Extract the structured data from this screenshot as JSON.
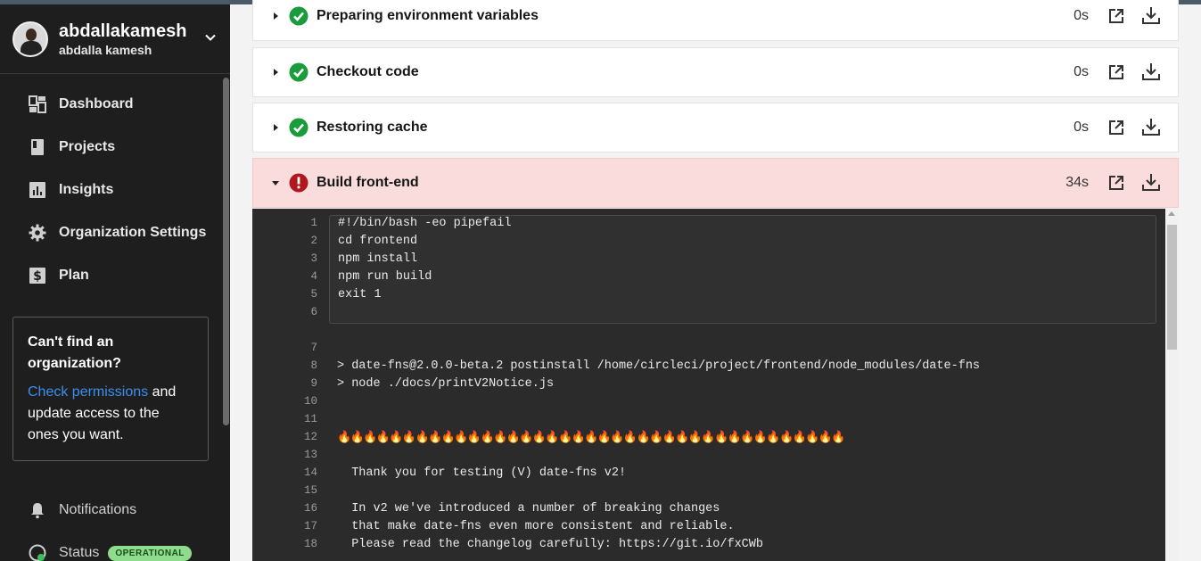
{
  "user": {
    "username": "abdallakamesh",
    "fullname": "abdalla kamesh"
  },
  "nav": [
    {
      "label": "Dashboard",
      "icon": "dashboard-icon"
    },
    {
      "label": "Projects",
      "icon": "projects-icon"
    },
    {
      "label": "Insights",
      "icon": "insights-icon"
    },
    {
      "label": "Organization Settings",
      "icon": "gear-icon"
    },
    {
      "label": "Plan",
      "icon": "dollar-icon"
    }
  ],
  "cant_find": {
    "title": "Can't find an organization?",
    "link": "Check permissions",
    "rest_1": " and",
    "rest_2": "update access to the ones you want."
  },
  "nav_bottom": {
    "notifications": "Notifications",
    "status": "Status",
    "status_badge": "OPERATIONAL"
  },
  "steps": [
    {
      "name": "Preparing environment variables",
      "duration": "0s",
      "state": "success"
    },
    {
      "name": "Checkout code",
      "duration": "0s",
      "state": "success"
    },
    {
      "name": "Restoring cache",
      "duration": "0s",
      "state": "success"
    },
    {
      "name": "Build front-end",
      "duration": "34s",
      "state": "failed"
    }
  ],
  "console": {
    "lines": [
      {
        "n": "1",
        "t": "#!/bin/bash -eo pipefail"
      },
      {
        "n": "2",
        "t": "cd frontend"
      },
      {
        "n": "3",
        "t": "npm install"
      },
      {
        "n": "4",
        "t": "npm run build"
      },
      {
        "n": "5",
        "t": "exit 1"
      },
      {
        "n": "6",
        "t": ""
      },
      {
        "n": "7",
        "t": ""
      },
      {
        "n": "8",
        "t": "> date-fns@2.0.0-beta.2 postinstall /home/circleci/project/frontend/node_modules/date-fns"
      },
      {
        "n": "9",
        "t": "> node ./docs/printV2Notice.js"
      },
      {
        "n": "10",
        "t": ""
      },
      {
        "n": "11",
        "t": ""
      },
      {
        "n": "12",
        "t": "🔥🔥🔥🔥🔥🔥🔥🔥🔥🔥🔥🔥🔥🔥🔥🔥🔥🔥🔥🔥🔥🔥🔥🔥🔥🔥🔥🔥🔥🔥🔥🔥🔥🔥🔥🔥🔥🔥🔥"
      },
      {
        "n": "13",
        "t": ""
      },
      {
        "n": "14",
        "t": "  Thank you for testing (V) date-fns v2!"
      },
      {
        "n": "15",
        "t": ""
      },
      {
        "n": "16",
        "t": "  In v2 we've introduced a number of breaking changes"
      },
      {
        "n": "17",
        "t": "  that make date-fns even more consistent and reliable."
      },
      {
        "n": "18",
        "t": "  Please read the changelog carefully: https://git.io/fxCWb"
      }
    ]
  },
  "colors": {
    "sidebar_bg": "#1e1e1e",
    "success": "#1a9b3c",
    "failed": "#b0171f",
    "failed_row_bg": "#fbdcdc",
    "link": "#3b8ff0",
    "console_bg": "#2b2b2b"
  }
}
